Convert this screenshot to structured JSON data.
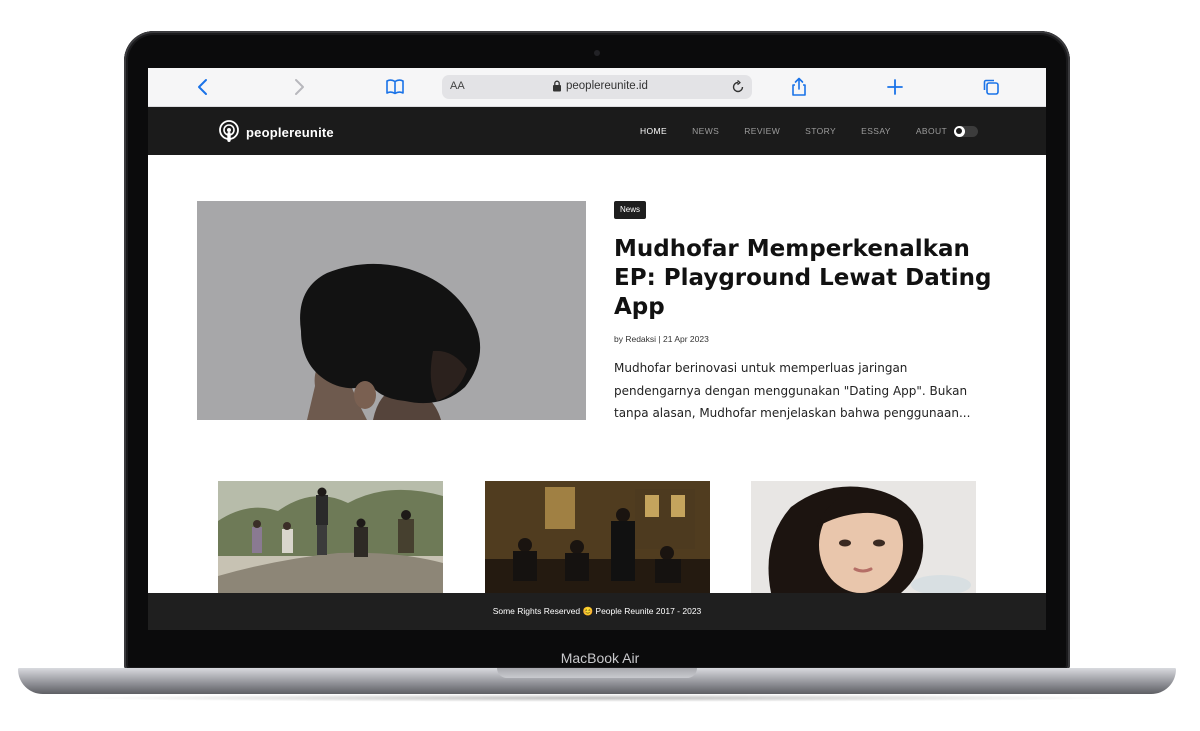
{
  "device": {
    "label": "MacBook Air"
  },
  "browser": {
    "text_size_label": "AA",
    "url": "peoplereunite.id"
  },
  "site": {
    "logo_text": "peoplereunite",
    "nav": [
      {
        "label": "HOME",
        "active": true
      },
      {
        "label": "NEWS",
        "active": false
      },
      {
        "label": "REVIEW",
        "active": false
      },
      {
        "label": "STORY",
        "active": false
      },
      {
        "label": "ESSAY",
        "active": false
      },
      {
        "label": "ABOUT",
        "active": false
      }
    ]
  },
  "featured": {
    "category": "News",
    "title": "Mudhofar Memperkenalkan EP: Playground Lewat Dating App",
    "byline": "by Redaksi | 21 Apr 2023",
    "excerpt": "Mudhofar berinovasi untuk memperluas jaringan pendengarnya dengan menggunakan \"Dating App\". Bukan tanpa alasan, Mudhofar menjelaskan bahwa penggunaan..."
  },
  "footer": {
    "text": "Some Rights Reserved 😊 People Reunite 2017 - 2023"
  },
  "colors": {
    "nav_bg": "#1b1b1b",
    "footer_bg": "#1f1f1f",
    "text": "#111111"
  }
}
